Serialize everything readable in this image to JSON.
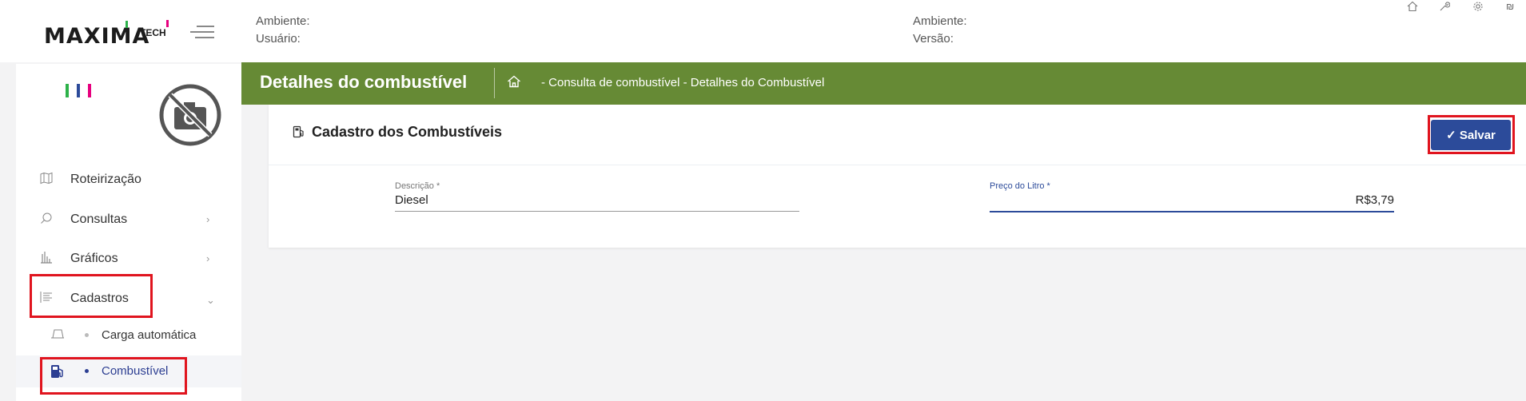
{
  "app": {
    "logo_text": "MAXIMA",
    "logo_suffix": "TECH",
    "colors": {
      "brand_green": "#668a35",
      "primary_blue": "#2c4b9a",
      "highlight_red": "#e0141e"
    }
  },
  "topbar": {
    "left_env_label": "Ambiente:",
    "left_user_label": "Usuário:",
    "right_env_label": "Ambiente:",
    "right_version_label": "Versão:",
    "icons": [
      "home-icon",
      "wrench-icon",
      "gear-icon",
      "currency-icon"
    ]
  },
  "sidebar": {
    "items": [
      {
        "label": "Roteirização",
        "icon": "map-icon"
      },
      {
        "label": "Consultas",
        "icon": "search-icon"
      },
      {
        "label": "Gráficos",
        "icon": "bar-chart-icon"
      },
      {
        "label": "Cadastros",
        "icon": "list-icon"
      }
    ],
    "subitems": [
      {
        "label": "Carga automática",
        "icon": "truck-icon"
      },
      {
        "label": "Combustível",
        "icon": "fuel-pump-icon"
      }
    ]
  },
  "header": {
    "title": "Detalhes do combustível",
    "breadcrumb": "- Consulta de combustível - Detalhes do Combustível"
  },
  "form": {
    "title": "Cadastro dos Combustíveis",
    "save_label": "Salvar",
    "description_label": "Descrição *",
    "description_value": "Diesel",
    "price_label": "Preço do Litro *",
    "price_value": "R$3,79"
  }
}
